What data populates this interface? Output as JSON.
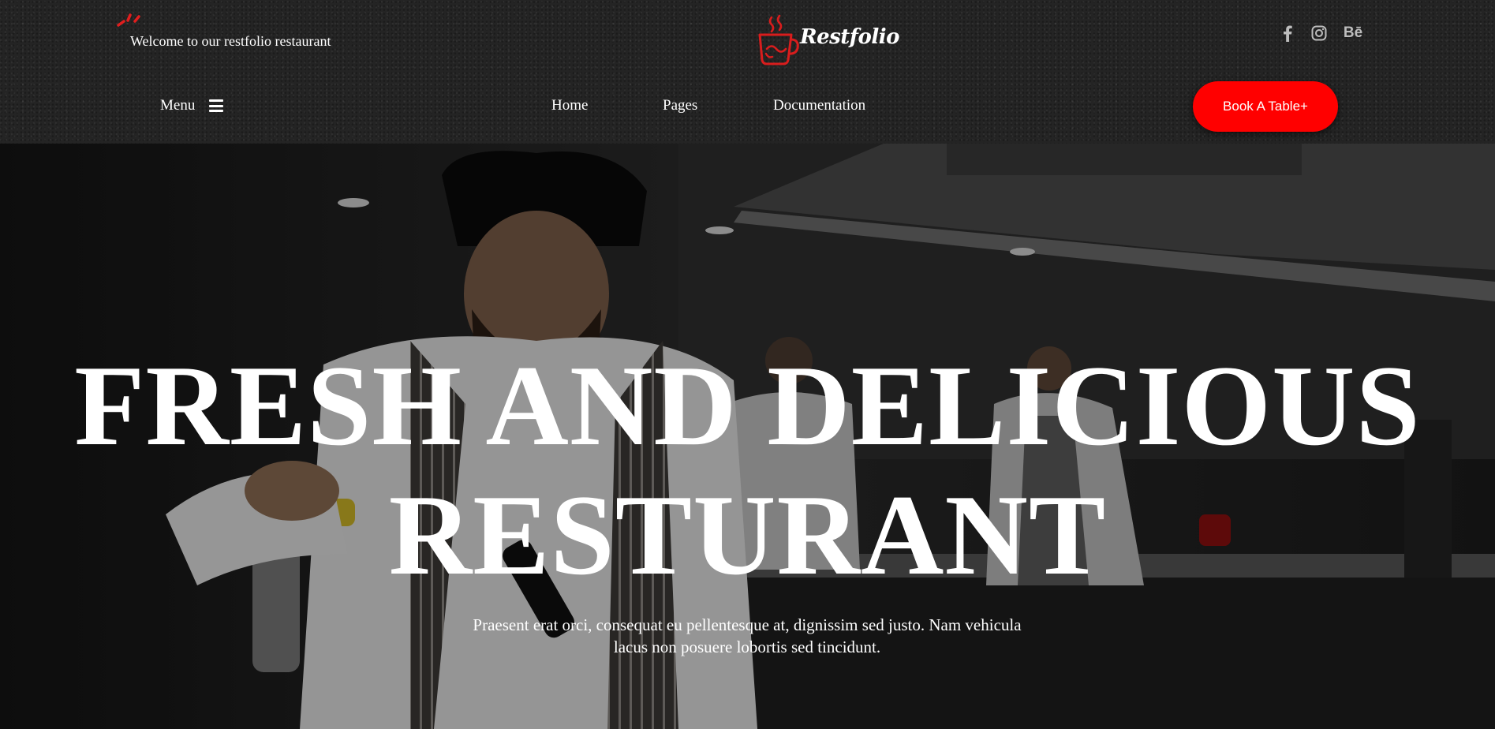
{
  "header": {
    "welcome_text": "Welcome to our restfolio restaurant",
    "logo_text": "Restfolio",
    "social": [
      {
        "icon": "facebook-icon"
      },
      {
        "icon": "instagram-icon"
      },
      {
        "icon": "behance-icon",
        "label": "Bē"
      }
    ],
    "menu_label": "Menu",
    "nav": [
      "Home",
      "Pages",
      "Documentation"
    ],
    "book_button": "Book A Table+"
  },
  "hero": {
    "title_line1": "FRESH AND DELICIOUS",
    "title_line2": "RESTURANT",
    "subtitle": "Praesent erat orci, consequat eu pellentesque at, dignissim sed justo. Nam vehicula lacus non posuere lobortis sed tincidunt."
  },
  "colors": {
    "accent": "#ff0000",
    "header_bg": "#242424",
    "text": "#ffffff",
    "icon_gray": "#bdbdbd"
  }
}
